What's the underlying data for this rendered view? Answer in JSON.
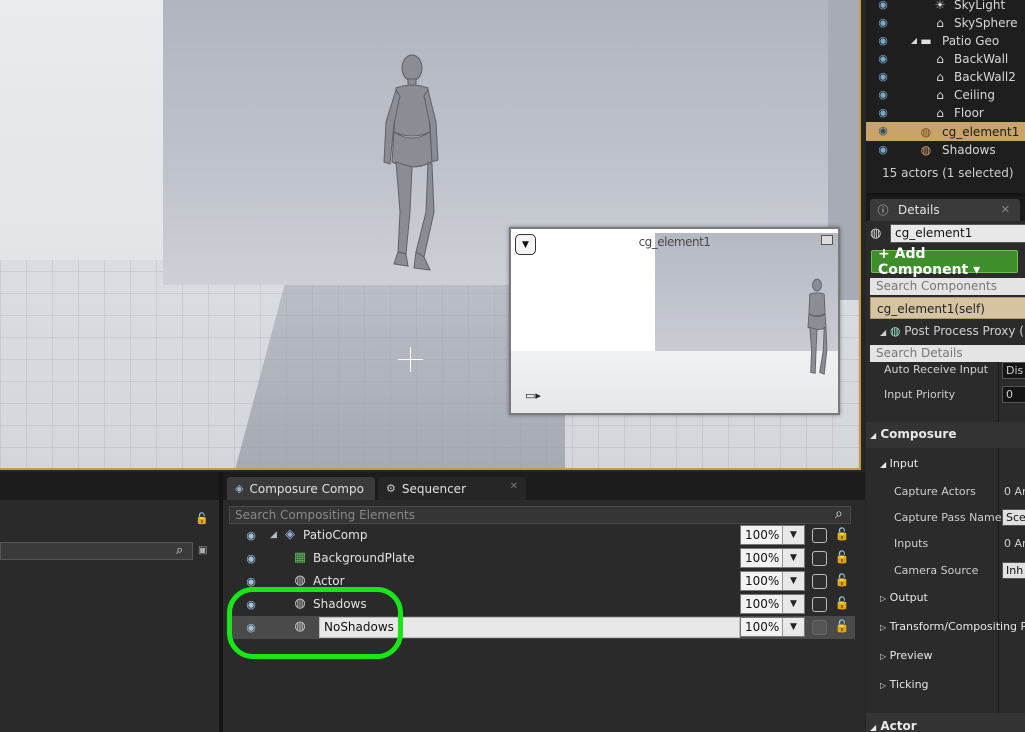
{
  "viewport": {
    "preview": {
      "title": "cg_element1",
      "menu_icon": "chevron-down-icon",
      "maximize_icon": "maximize-icon",
      "camera_icon": "camera-icon"
    }
  },
  "outliner": {
    "rows": [
      {
        "label": "SkyLight",
        "icon": "skylight-icon",
        "indent": 2
      },
      {
        "label": "SkySphere",
        "icon": "actor-icon",
        "indent": 2
      },
      {
        "label": "Patio Geo",
        "icon": "folder-icon",
        "indent": 1,
        "expanded": true
      },
      {
        "label": "BackWall",
        "icon": "actor-icon",
        "indent": 2
      },
      {
        "label": "BackWall2",
        "icon": "actor-icon",
        "indent": 2
      },
      {
        "label": "Ceiling",
        "icon": "actor-icon",
        "indent": 2
      },
      {
        "label": "Floor",
        "icon": "actor-icon",
        "indent": 2
      },
      {
        "label": "cg_element1",
        "icon": "element-icon",
        "indent": 1,
        "selected": true
      },
      {
        "label": "Shadows",
        "icon": "element-icon",
        "indent": 1
      }
    ],
    "footer": "15 actors (1 selected)"
  },
  "details": {
    "tab_label": "Details",
    "actor_name": "cg_element1",
    "add_component_label": "+ Add Component ▾",
    "search_components_placeholder": "Search Components",
    "component_self": "cg_element1(self)",
    "component_child": "Post Process Proxy (P",
    "search_details_placeholder": "Search Details",
    "props": [
      {
        "label": "Auto Receive Input",
        "value": "Dis"
      },
      {
        "label": "Input Priority",
        "value": "0"
      }
    ],
    "composure_section": "Composure",
    "input_section": "Input",
    "input_props": [
      {
        "label": "Capture Actors",
        "value": "0 Ar"
      },
      {
        "label": "Capture Pass Name",
        "value": "Sce"
      },
      {
        "label": "Inputs",
        "value": "0 Ar"
      },
      {
        "label": "Camera Source",
        "value": "Inh"
      }
    ],
    "collapsed_sections": [
      "Output",
      "Transform/Compositing Pa",
      "Preview",
      "Ticking"
    ],
    "actor_section": "Actor"
  },
  "composure": {
    "tabs": [
      {
        "label": "Composure Compo",
        "icon": "layers-icon",
        "active": true
      },
      {
        "label": "Sequencer",
        "icon": "sequencer-icon",
        "active": false
      }
    ],
    "search_placeholder": "Search Compositing Elements",
    "rows": [
      {
        "label": "PatioComp",
        "icon": "comp-icon",
        "opacity": "100%",
        "level": 0,
        "expanded": true
      },
      {
        "label": "BackgroundPlate",
        "icon": "film-icon",
        "opacity": "100%",
        "level": 1
      },
      {
        "label": "Actor",
        "icon": "element-icon",
        "opacity": "100%",
        "level": 1
      },
      {
        "label": "Shadows",
        "icon": "element-icon",
        "opacity": "100%",
        "level": 1
      },
      {
        "label": "NoShadows",
        "icon": "element-icon",
        "opacity": "100%",
        "level": 1,
        "selected": true,
        "editing": true
      }
    ]
  },
  "colors": {
    "highlight_ring": "#17e617",
    "selection": "#c8a46a",
    "add_button": "#3e8e2c"
  }
}
